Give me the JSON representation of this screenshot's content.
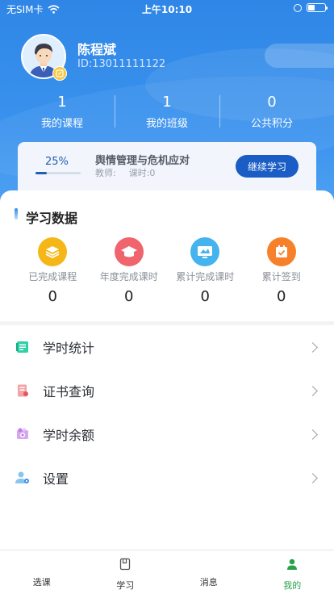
{
  "status_bar": {
    "carrier": "无SIM卡",
    "time": "上午10:10"
  },
  "profile": {
    "name": "陈程斌",
    "id": "ID:13011111122"
  },
  "stats": [
    {
      "value": "1",
      "label": "我的课程"
    },
    {
      "value": "1",
      "label": "我的班级"
    },
    {
      "value": "0",
      "label": "公共积分"
    }
  ],
  "current_course": {
    "progress": "25%",
    "progress_fraction": 0.25,
    "title": "舆情管理与危机应对",
    "teacher": "教师:",
    "hours": "课时:0",
    "continue_label": "继续学习"
  },
  "study_data": {
    "title": "学习数据",
    "items": [
      {
        "label": "已完成课程",
        "value": "0",
        "icon": "layers-icon",
        "color": "#f5b718"
      },
      {
        "label": "年度完成课时",
        "value": "0",
        "icon": "graduation-cap-icon",
        "color": "#f0646d"
      },
      {
        "label": "累计完成课时",
        "value": "0",
        "icon": "monitor-icon",
        "color": "#44b3ee"
      },
      {
        "label": "累计签到",
        "value": "0",
        "icon": "calendar-check-icon",
        "color": "#f6812a"
      }
    ]
  },
  "menu": [
    {
      "label": "学时统计",
      "icon": "notebook-icon"
    },
    {
      "label": "证书查询",
      "icon": "certificate-icon"
    },
    {
      "label": "学时余额",
      "icon": "wallet-icon"
    },
    {
      "label": "设置",
      "icon": "user-settings-icon"
    }
  ],
  "tabbar": [
    {
      "label": "选课",
      "active": false
    },
    {
      "label": "学习",
      "active": false
    },
    {
      "label": "消息",
      "active": false
    },
    {
      "label": "我的",
      "active": true
    }
  ],
  "colors": {
    "header": "#3b93ee",
    "primary_button": "#1a5dc4",
    "active_tab": "#27a24a"
  }
}
